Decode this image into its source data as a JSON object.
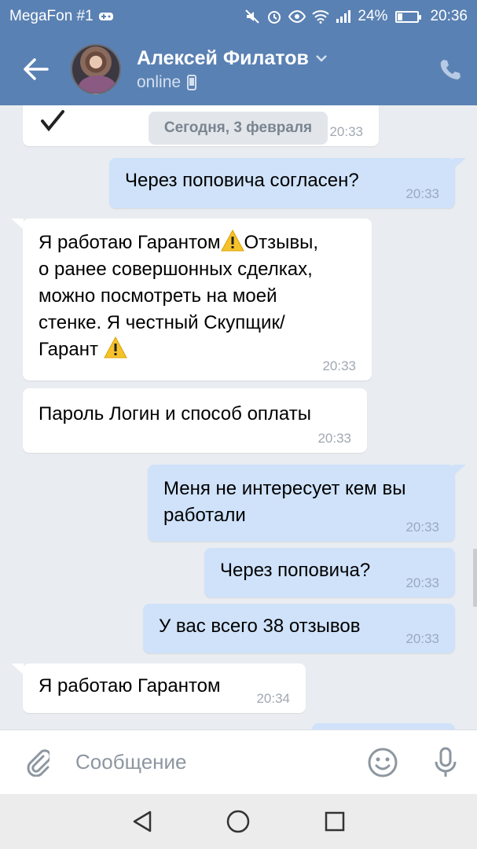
{
  "status_bar": {
    "carrier": "MegaFon #1",
    "battery_percent": "24%",
    "battery_level": 0.24,
    "time": "20:36",
    "icons": [
      "game-icon",
      "mute-icon",
      "alarm-icon",
      "eye-icon",
      "wifi-icon",
      "signal-icon",
      "battery-icon"
    ]
  },
  "header": {
    "contact_name": "Алексей Филатов",
    "status": "online",
    "icons": [
      "back-arrow-icon",
      "chevron-down-icon",
      "mobile-icon",
      "phone-icon"
    ]
  },
  "chat": {
    "date_separator": "Сегодня, 3 февраля",
    "partial_top_time": "20:33",
    "messages": [
      {
        "direction": "out",
        "text": "Через поповича согласен?",
        "time": "20:33"
      },
      {
        "direction": "in",
        "lines": [
          "Я работаю Гарантом",
          "Отзывы,",
          "о ранее совершонных сделках,",
          "можно посмотреть на моей",
          "стенке. Я честный Скупщик/",
          "Гарант"
        ],
        "time": "20:33"
      },
      {
        "direction": "in",
        "text": "Пароль Логин и способ оплаты",
        "time": "20:33"
      },
      {
        "direction": "out",
        "lines": [
          "Меня не интересует кем вы",
          "работали"
        ],
        "time": "20:33"
      },
      {
        "direction": "out",
        "text": "Через поповича?",
        "time": "20:33"
      },
      {
        "direction": "out",
        "text": "У вас всего 38 отзывов",
        "time": "20:33"
      },
      {
        "direction": "in",
        "text": "Я работаю Гарантом",
        "time": "20:34"
      }
    ]
  },
  "composer": {
    "placeholder": "Сообщение",
    "icons": [
      "paperclip-icon",
      "emoji-icon",
      "microphone-icon"
    ]
  },
  "nav": {
    "icons": [
      "nav-back-icon",
      "nav-home-icon",
      "nav-recents-icon"
    ]
  },
  "colors": {
    "header_bg": "#5a81b3",
    "chat_bg": "#e9ecf0",
    "incoming_bubble": "#ffffff",
    "outgoing_bubble": "#cfe2fa",
    "time_text": "#a0a8b3"
  }
}
